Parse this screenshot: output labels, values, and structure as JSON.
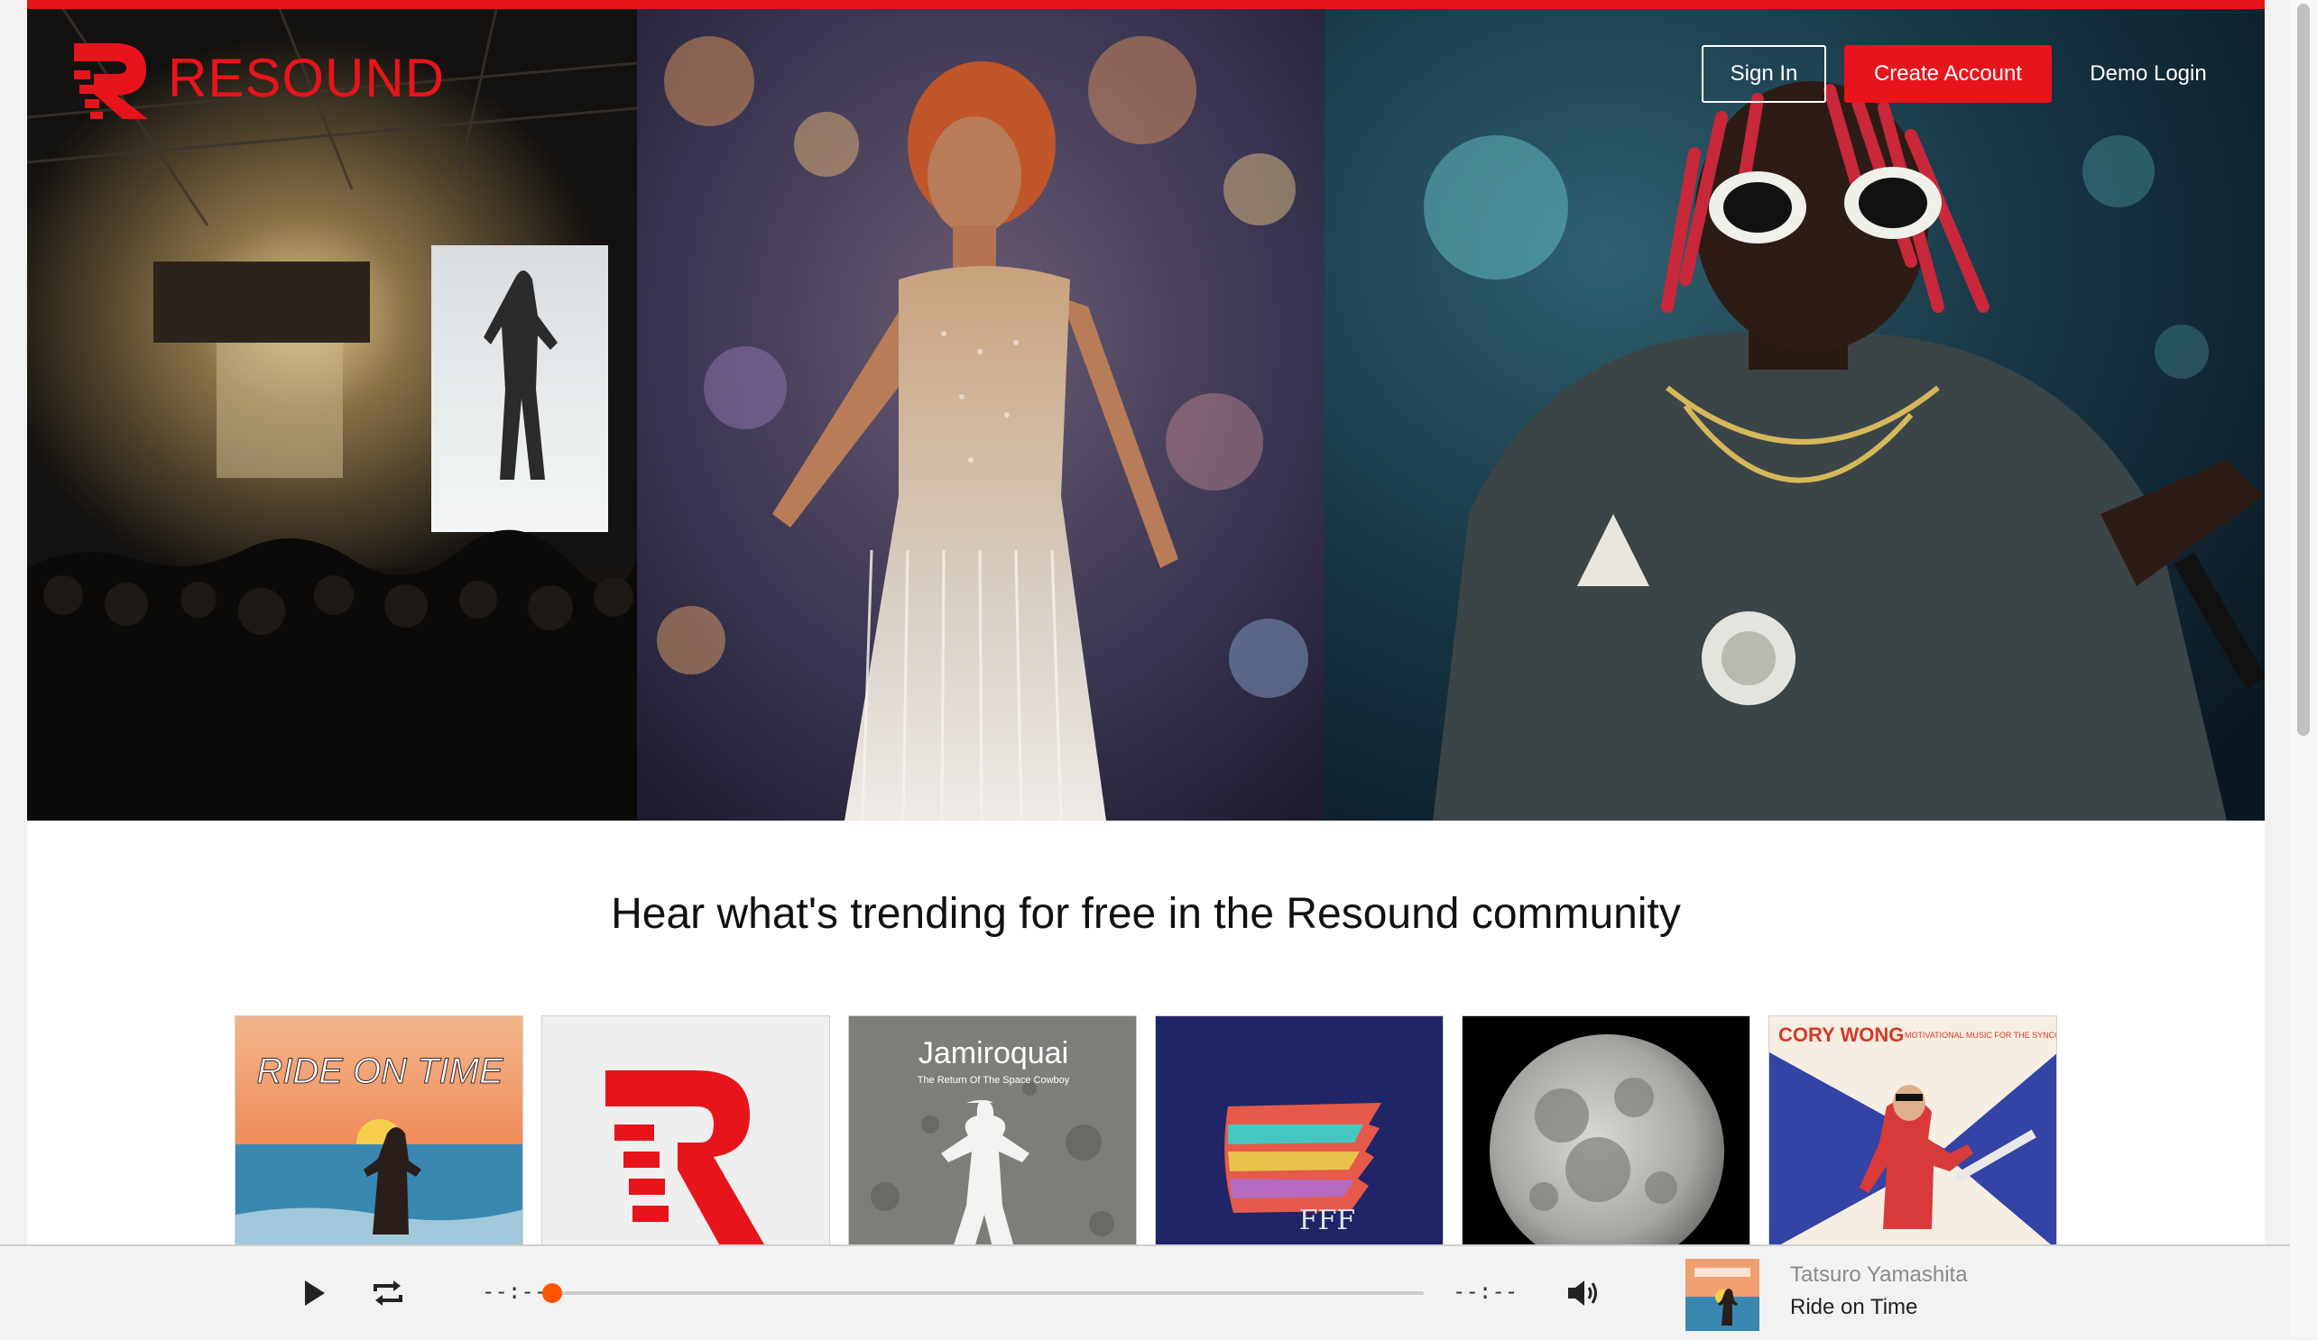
{
  "brand": {
    "name": "RESOUND",
    "accent_color": "#e8141b"
  },
  "nav": {
    "sign_in": "Sign In",
    "create_account": "Create Account",
    "demo_login": "Demo Login"
  },
  "hero": {
    "panels": [
      "concert-stage-photo",
      "performer-photo",
      "rapper-photo"
    ]
  },
  "main": {
    "heading": "Hear what's trending for free in the Resound community",
    "albums": [
      {
        "cover": "ride-on-time-cover",
        "title_text": "RIDE ON TIME"
      },
      {
        "cover": "resound-default-cover",
        "title_text": ""
      },
      {
        "cover": "jamiroquai-cover",
        "title_text": "Jamiroquai",
        "subtitle_text": "The Return Of The Space Cowboy"
      },
      {
        "cover": "fff-cover",
        "title_text": "FFF"
      },
      {
        "cover": "moon-cover",
        "title_text": ""
      },
      {
        "cover": "cory-wong-cover",
        "title_text": "CORY WONG",
        "subtitle_text": "MOTIVATIONAL MUSIC FOR THE SYNCOPATED SOUL"
      }
    ]
  },
  "player": {
    "elapsed": "--:--",
    "duration": "--:--",
    "progress": 0,
    "artist": "Tatsuro Yamashita",
    "track": "Ride on Time",
    "progress_color": "#ff5500",
    "icons": [
      "play-icon",
      "repeat-icon",
      "volume-icon"
    ]
  }
}
